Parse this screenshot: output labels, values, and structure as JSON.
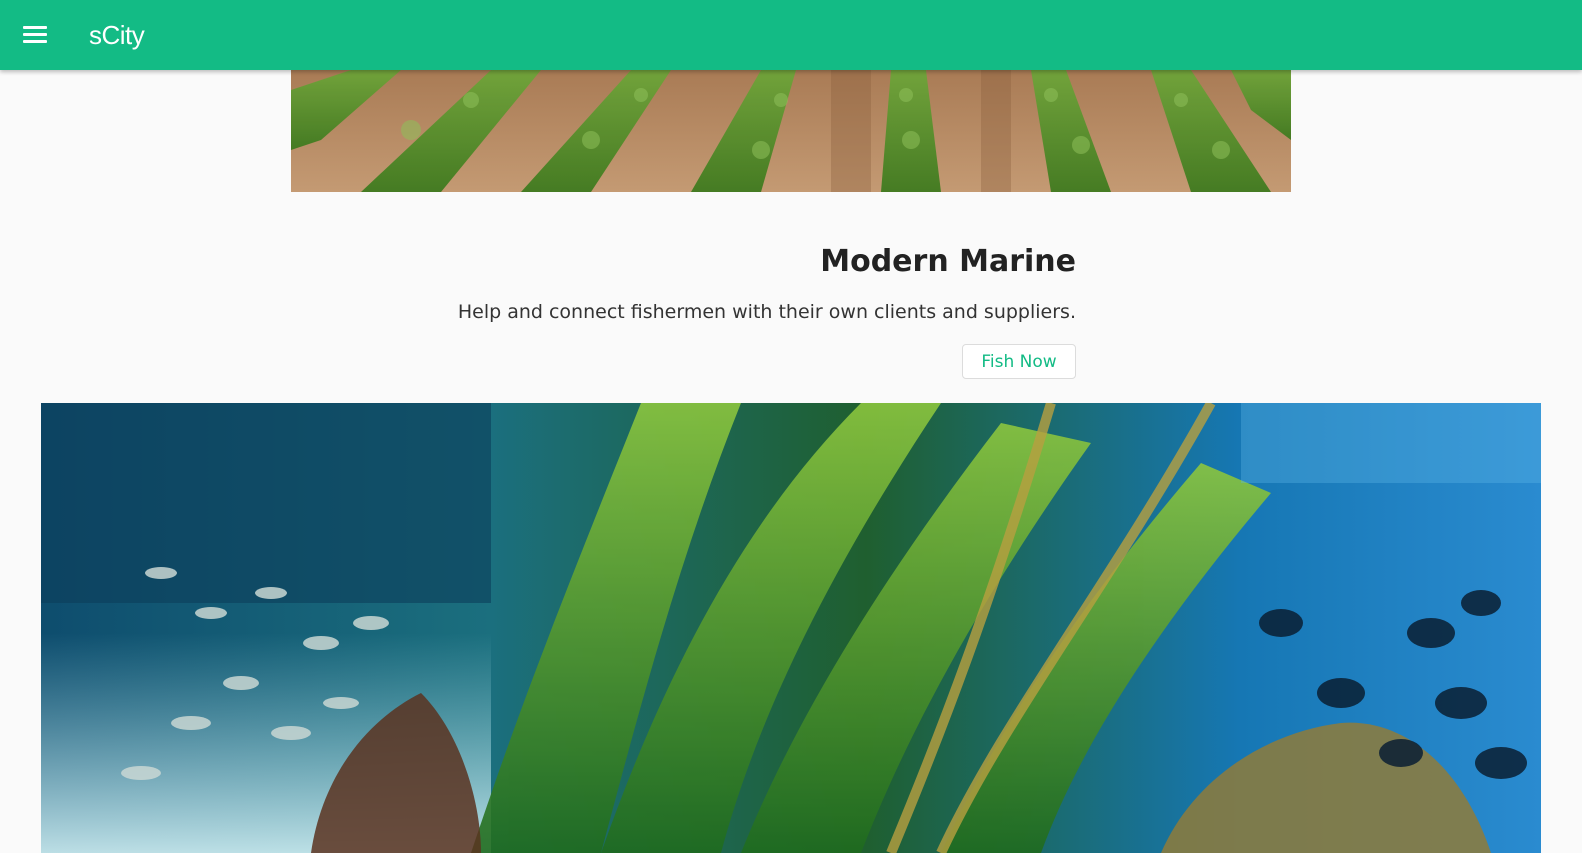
{
  "app_bar": {
    "title": "sCity",
    "menu_icon": "hamburger-menu-icon",
    "background_color": "#13bb85"
  },
  "sections": {
    "farm": {
      "image": "crop-field-photo"
    },
    "marine": {
      "title": "Modern Marine",
      "description": "Help and connect fishermen with their own clients and suppliers.",
      "cta_label": "Fish Now",
      "image": "underwater-reef-photo",
      "accent_color": "#13bb85"
    }
  }
}
